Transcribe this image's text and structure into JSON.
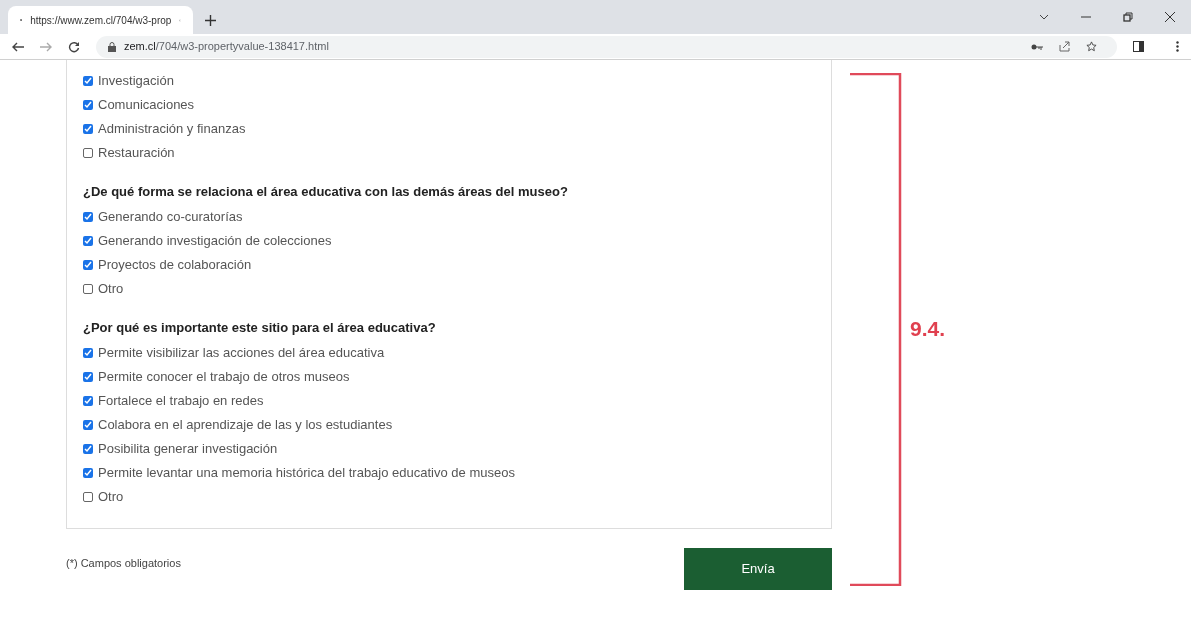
{
  "browser": {
    "tab_title": "https://www.zem.cl/704/w3-prop",
    "url_host": "zem.cl",
    "url_path": "/704/w3-propertyvalue-138417.html"
  },
  "form": {
    "first_options": [
      {
        "label": "Investigación",
        "checked": true
      },
      {
        "label": "Comunicaciones",
        "checked": true
      },
      {
        "label": "Administración y finanzas",
        "checked": true
      },
      {
        "label": "Restauración",
        "checked": false
      }
    ],
    "questions": [
      {
        "title": "¿De qué forma se relaciona el área educativa con las demás áreas del museo?",
        "options": [
          {
            "label": "Generando co-curatorías",
            "checked": true
          },
          {
            "label": "Generando investigación de colecciones",
            "checked": true
          },
          {
            "label": "Proyectos de colaboración",
            "checked": true
          },
          {
            "label": "Otro",
            "checked": false
          }
        ]
      },
      {
        "title": "¿Por qué es importante este sitio para el área educativa?",
        "options": [
          {
            "label": "Permite visibilizar las acciones del área educativa",
            "checked": true
          },
          {
            "label": "Permite conocer el trabajo de otros museos",
            "checked": true
          },
          {
            "label": "Fortalece el trabajo en redes",
            "checked": true
          },
          {
            "label": "Colabora en el aprendizaje de las y los estudiantes",
            "checked": true
          },
          {
            "label": "Posibilita generar investigación",
            "checked": true
          },
          {
            "label": "Permite levantar una memoria histórica del trabajo educativo de museos",
            "checked": true
          },
          {
            "label": "Otro",
            "checked": false
          }
        ]
      }
    ],
    "required_note": "(*) Campos obligatorios",
    "submit": "Envía"
  },
  "annotation": {
    "label": "9.4."
  }
}
